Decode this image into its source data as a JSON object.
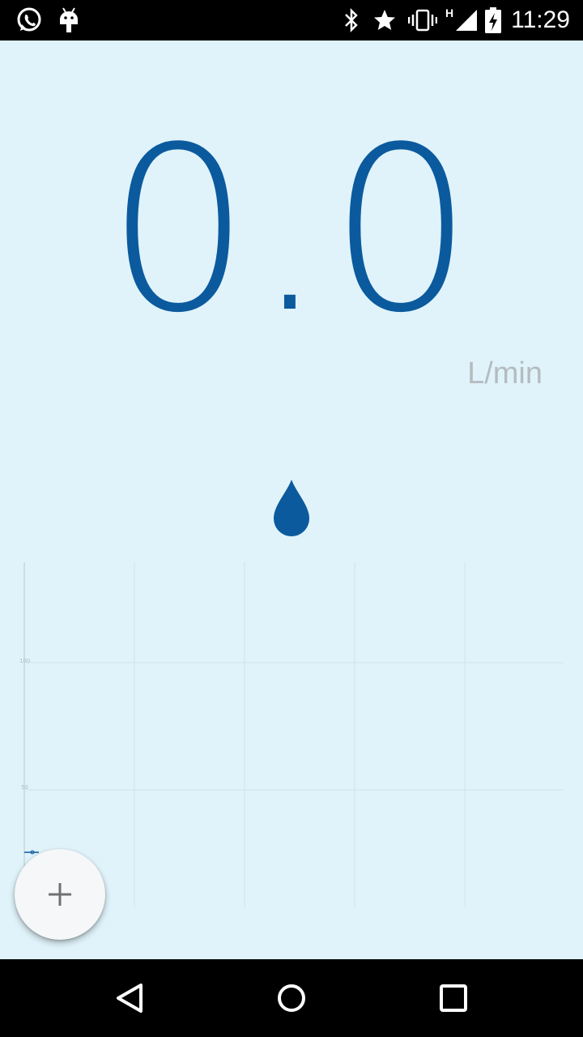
{
  "status_bar": {
    "time": "11:29",
    "network_label": "H",
    "left_icons": [
      "whatsapp-icon",
      "android-icon"
    ],
    "right_icons": [
      "bluetooth-icon",
      "star-icon",
      "vibrate-icon",
      "signal-icon",
      "battery-charging-icon"
    ]
  },
  "flow": {
    "value": "0.0",
    "unit": "L/min",
    "icon": "water-drop-icon",
    "accent_color": "#0b5a9e"
  },
  "chart_data": {
    "type": "line",
    "y_tick_labels": [
      "100",
      "50"
    ],
    "series": [
      {
        "values": [
          0
        ]
      }
    ],
    "grid": true
  },
  "fab": {
    "label": "+",
    "icon": "plus-icon"
  },
  "nav_bar": {
    "buttons": [
      "back-icon",
      "home-icon",
      "recents-icon"
    ]
  }
}
